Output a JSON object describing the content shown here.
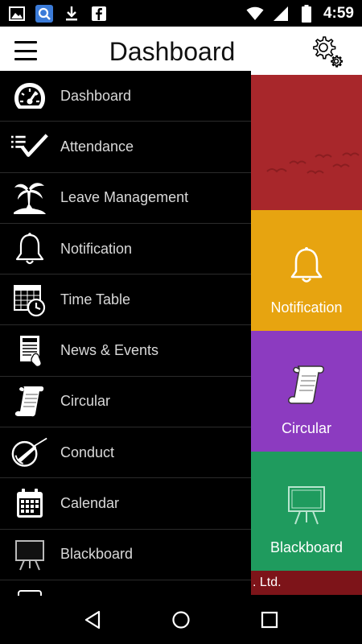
{
  "status_bar": {
    "time": "4:59",
    "left_icons": [
      "image-icon",
      "search-app-icon",
      "download-icon",
      "facebook-icon"
    ],
    "right_icons": [
      "wifi-icon",
      "signal-icon",
      "battery-icon"
    ]
  },
  "app_bar": {
    "title": "Dashboard",
    "menu_icon": "hamburger-menu-icon",
    "settings_icon": "gear-icon"
  },
  "drawer": {
    "items": [
      {
        "label": "Dashboard",
        "icon": "speedometer-icon"
      },
      {
        "label": "Attendance",
        "icon": "checklist-icon"
      },
      {
        "label": "Leave Management",
        "icon": "palm-tree-icon"
      },
      {
        "label": "Notification",
        "icon": "bell-icon"
      },
      {
        "label": "Time Table",
        "icon": "timetable-icon"
      },
      {
        "label": "News & Events",
        "icon": "newspaper-icon"
      },
      {
        "label": "Circular",
        "icon": "scroll-icon"
      },
      {
        "label": "Conduct",
        "icon": "conduct-icon"
      },
      {
        "label": "Calendar",
        "icon": "calendar-icon"
      },
      {
        "label": "Blackboard",
        "icon": "blackboard-icon"
      }
    ]
  },
  "tiles": {
    "notification": {
      "label": "Notification",
      "icon": "bell-icon",
      "color": "#e7a410"
    },
    "circular": {
      "label": "Circular",
      "icon": "scroll-icon",
      "color": "#8c3bc0"
    },
    "blackboard": {
      "label": "Blackboard",
      "icon": "blackboard-icon",
      "color": "#1f9b5e"
    },
    "banner": {
      "icon": "birds-icon",
      "color": "#a8272b"
    },
    "footer": {
      "text": ". Ltd.",
      "color": "#7d1419"
    }
  },
  "nav_bar": {
    "icons": [
      "back-icon",
      "home-icon",
      "recents-icon"
    ]
  }
}
